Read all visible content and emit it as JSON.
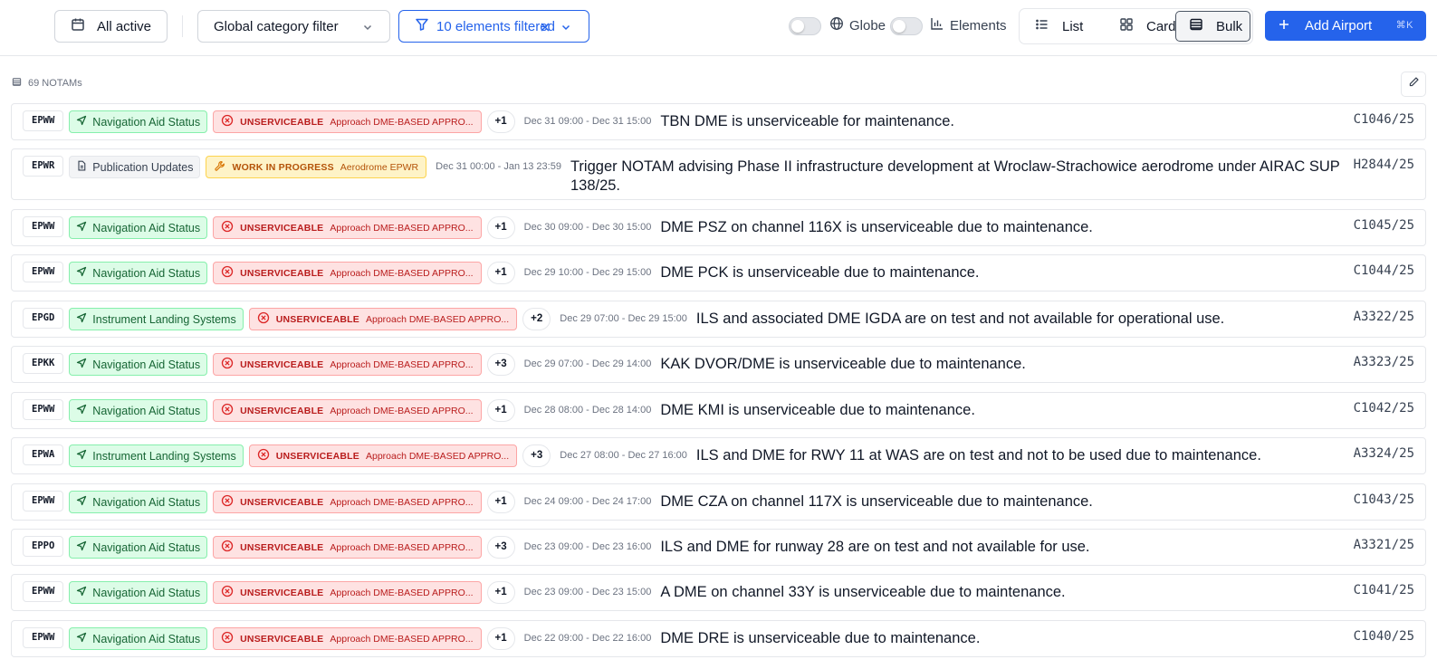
{
  "toolbar": {
    "date_filter_label": "All active",
    "category_filter_label": "Global category filter",
    "elements_filter_label": "10 elements filtered",
    "globe_label": "Globe",
    "elements_label": "Elements",
    "view_list_label": "List",
    "view_card_label": "Card",
    "view_bulk_label": "Bulk",
    "selected_view": "Bulk",
    "globe_toggle_on": false,
    "elements_toggle_on": false,
    "add_airport_label": "Add Airport",
    "add_airport_shortcut": "⌘K"
  },
  "list": {
    "count_label": "69 NOTAMs"
  },
  "colors": {
    "accent": "#2563eb",
    "nav_green": "#dcfce7",
    "unserviceable_red": "#fee2e2",
    "work_in_progress_amber": "#fef3c7"
  },
  "notams": [
    {
      "airport": "EPWW",
      "category": "Navigation Aid Status",
      "category_icon": "navigation-arrow-icon",
      "status": "UNSERVICEABLE",
      "status_icon": "x-circle-icon",
      "status_detail": "Approach DME-BASED APPRO...",
      "extra": "+1",
      "dates": "Dec 31 09:00 - Dec 31 15:00",
      "description": "TBN DME is unserviceable for maintenance.",
      "id": "C1046/25"
    },
    {
      "airport": "EPWR",
      "category": "Publication Updates",
      "category_icon": "document-icon",
      "status": "WORK IN PROGRESS",
      "status_icon": "wrench-icon",
      "status_detail": "Aerodrome EPWR",
      "extra": "",
      "dates": "Dec 31 00:00 - Jan 13 23:59",
      "description": "Trigger NOTAM advising Phase II infrastructure development at Wroclaw-Strachowice aerodrome under AIRAC SUP 138/25.",
      "id": "H2844/25"
    },
    {
      "airport": "EPWW",
      "category": "Navigation Aid Status",
      "category_icon": "navigation-arrow-icon",
      "status": "UNSERVICEABLE",
      "status_icon": "x-circle-icon",
      "status_detail": "Approach DME-BASED APPRO...",
      "extra": "+1",
      "dates": "Dec 30 09:00 - Dec 30 15:00",
      "description": "DME PSZ on channel 116X is unserviceable due to maintenance.",
      "id": "C1045/25"
    },
    {
      "airport": "EPWW",
      "category": "Navigation Aid Status",
      "category_icon": "navigation-arrow-icon",
      "status": "UNSERVICEABLE",
      "status_icon": "x-circle-icon",
      "status_detail": "Approach DME-BASED APPRO...",
      "extra": "+1",
      "dates": "Dec 29 10:00 - Dec 29 15:00",
      "description": "DME PCK is unserviceable due to maintenance.",
      "id": "C1044/25"
    },
    {
      "airport": "EPGD",
      "category": "Instrument Landing Systems",
      "category_icon": "navigation-arrow-icon",
      "status": "UNSERVICEABLE",
      "status_icon": "x-circle-icon",
      "status_detail": "Approach DME-BASED APPRO...",
      "extra": "+2",
      "dates": "Dec 29 07:00 - Dec 29 15:00",
      "description": "ILS and associated DME IGDA are on test and not available for operational use.",
      "id": "A3322/25"
    },
    {
      "airport": "EPKK",
      "category": "Navigation Aid Status",
      "category_icon": "navigation-arrow-icon",
      "status": "UNSERVICEABLE",
      "status_icon": "x-circle-icon",
      "status_detail": "Approach DME-BASED APPRO...",
      "extra": "+3",
      "dates": "Dec 29 07:00 - Dec 29 14:00",
      "description": "KAK DVOR/DME is unserviceable due to maintenance.",
      "id": "A3323/25"
    },
    {
      "airport": "EPWW",
      "category": "Navigation Aid Status",
      "category_icon": "navigation-arrow-icon",
      "status": "UNSERVICEABLE",
      "status_icon": "x-circle-icon",
      "status_detail": "Approach DME-BASED APPRO...",
      "extra": "+1",
      "dates": "Dec 28 08:00 - Dec 28 14:00",
      "description": "DME KMI is unserviceable due to maintenance.",
      "id": "C1042/25"
    },
    {
      "airport": "EPWA",
      "category": "Instrument Landing Systems",
      "category_icon": "navigation-arrow-icon",
      "status": "UNSERVICEABLE",
      "status_icon": "x-circle-icon",
      "status_detail": "Approach DME-BASED APPRO...",
      "extra": "+3",
      "dates": "Dec 27 08:00 - Dec 27 16:00",
      "description": "ILS and DME for RWY 11 at WAS are on test and not to be used due to maintenance.",
      "id": "A3324/25"
    },
    {
      "airport": "EPWW",
      "category": "Navigation Aid Status",
      "category_icon": "navigation-arrow-icon",
      "status": "UNSERVICEABLE",
      "status_icon": "x-circle-icon",
      "status_detail": "Approach DME-BASED APPRO...",
      "extra": "+1",
      "dates": "Dec 24 09:00 - Dec 24 17:00",
      "description": "DME CZA on channel 117X is unserviceable due to maintenance.",
      "id": "C1043/25"
    },
    {
      "airport": "EPPO",
      "category": "Navigation Aid Status",
      "category_icon": "navigation-arrow-icon",
      "status": "UNSERVICEABLE",
      "status_icon": "x-circle-icon",
      "status_detail": "Approach DME-BASED APPRO...",
      "extra": "+3",
      "dates": "Dec 23 09:00 - Dec 23 16:00",
      "description": "ILS and DME for runway 28 are on test and not available for use.",
      "id": "A3321/25"
    },
    {
      "airport": "EPWW",
      "category": "Navigation Aid Status",
      "category_icon": "navigation-arrow-icon",
      "status": "UNSERVICEABLE",
      "status_icon": "x-circle-icon",
      "status_detail": "Approach DME-BASED APPRO...",
      "extra": "+1",
      "dates": "Dec 23 09:00 - Dec 23 15:00",
      "description": "A DME on channel 33Y is unserviceable due to maintenance.",
      "id": "C1041/25"
    },
    {
      "airport": "EPWW",
      "category": "Navigation Aid Status",
      "category_icon": "navigation-arrow-icon",
      "status": "UNSERVICEABLE",
      "status_icon": "x-circle-icon",
      "status_detail": "Approach DME-BASED APPRO...",
      "extra": "+1",
      "dates": "Dec 22 09:00 - Dec 22 16:00",
      "description": "DME DRE is unserviceable due to maintenance.",
      "id": "C1040/25"
    }
  ]
}
